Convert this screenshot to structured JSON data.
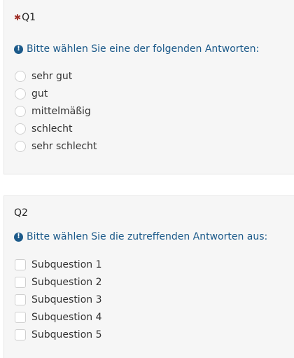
{
  "q1": {
    "mandatory_mark": "✱",
    "title": "Q1",
    "help_icon": "info-icon",
    "help_text": "Bitte wählen Sie eine der folgenden Antworten:",
    "options": [
      "sehr gut",
      "gut",
      "mittelmäßig",
      "schlecht",
      "sehr schlecht"
    ]
  },
  "q2": {
    "title": "Q2",
    "help_icon": "info-icon",
    "help_text": "Bitte wählen Sie die zutreffenden Antworten aus:",
    "options": [
      "Subquestion 1",
      "Subquestion 2",
      "Subquestion 3",
      "Subquestion 4",
      "Subquestion 5"
    ]
  },
  "colors": {
    "mandatory": "#a0322a",
    "help": "#1c5a8a",
    "panel_bg": "#f6f6f6"
  }
}
